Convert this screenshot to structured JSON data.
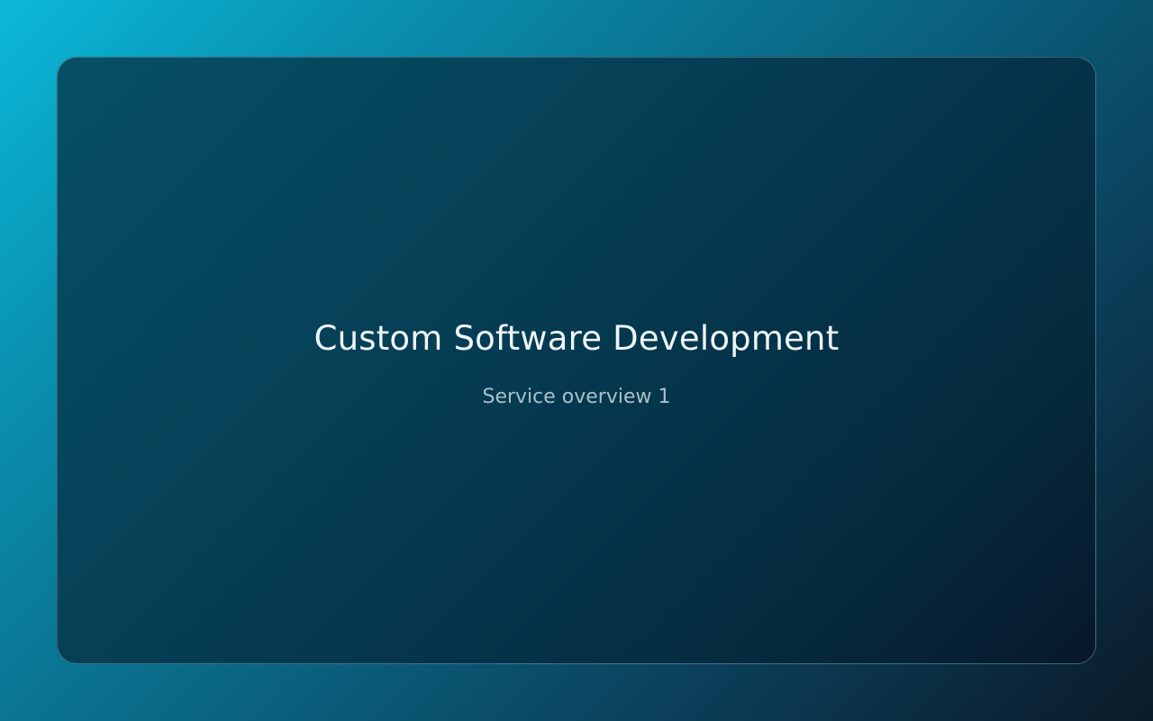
{
  "slide": {
    "title": "Custom Software Development",
    "subtitle": "Service overview 1"
  },
  "colors": {
    "background_start": "#0bb8d9",
    "background_end": "#0b1a28",
    "card_start": "#075064",
    "card_end": "#07182a",
    "title_text": "#eef5f8",
    "subtitle_text": "#a9c1cb"
  }
}
